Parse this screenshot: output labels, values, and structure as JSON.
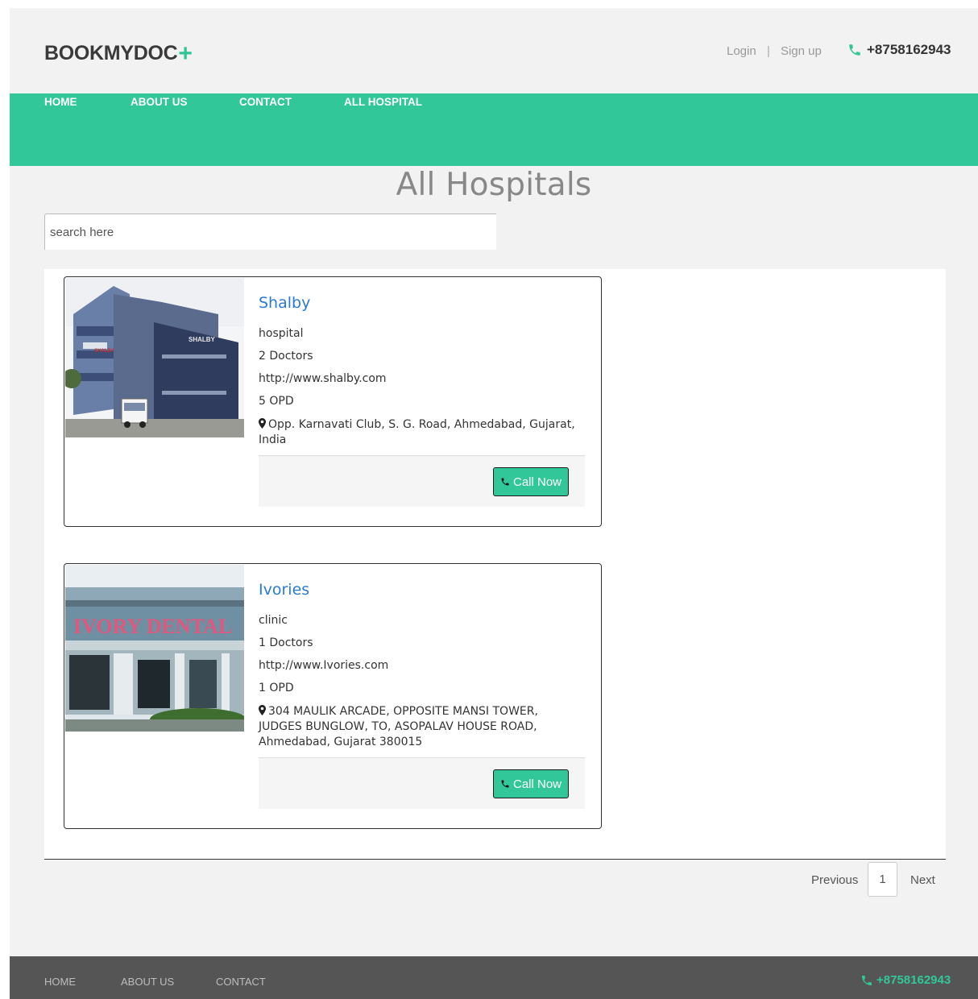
{
  "header": {
    "logo_text": "BOOKMYDOC",
    "logo_plus": "+",
    "login": "Login",
    "separator": "|",
    "signup": "Sign up",
    "phone": "+8758162943",
    "phone_icon": "phone-icon"
  },
  "nav": {
    "items": [
      {
        "label": "HOME"
      },
      {
        "label": "ABOUT US"
      },
      {
        "label": "CONTACT"
      },
      {
        "label": "ALL HOSPITAL"
      }
    ]
  },
  "main": {
    "title": "All Hospitals",
    "search_placeholder": "search here"
  },
  "hospitals": [
    {
      "name": "Shalby",
      "type": "hospital",
      "doctors": "2 Doctors",
      "website": "http://www.shalby.com",
      "opd": "5 OPD",
      "address": "Opp. Karnavati Club, S. G. Road, Ahmedabad, Gujarat, India",
      "call_label": "Call Now",
      "image_sign": "SHALBY",
      "image_sign2": "SHALBY"
    },
    {
      "name": "Ivories",
      "type": "clinic",
      "doctors": "1 Doctors",
      "website": "http://www.Ivories.com",
      "opd": "1 OPD",
      "address": "304 MAULIK ARCADE, OPPOSITE MANSI TOWER, JUDGES BUNGLOW, TO, ASOPALAV HOUSE ROAD, Ahmedabad, Gujarat 380015",
      "call_label": "Call Now",
      "image_sign": "IVORY DENTAL"
    }
  ],
  "pagination": {
    "previous": "Previous",
    "current": "1",
    "next": "Next"
  },
  "footer": {
    "items": [
      {
        "label": "HOME"
      },
      {
        "label": "ABOUT US"
      },
      {
        "label": "CONTACT"
      }
    ],
    "phone": "+8758162943"
  },
  "colors": {
    "accent": "#31c798",
    "link": "#2a7ad8",
    "footer_bg": "#555555",
    "page_bg": "#f2f2f2"
  }
}
